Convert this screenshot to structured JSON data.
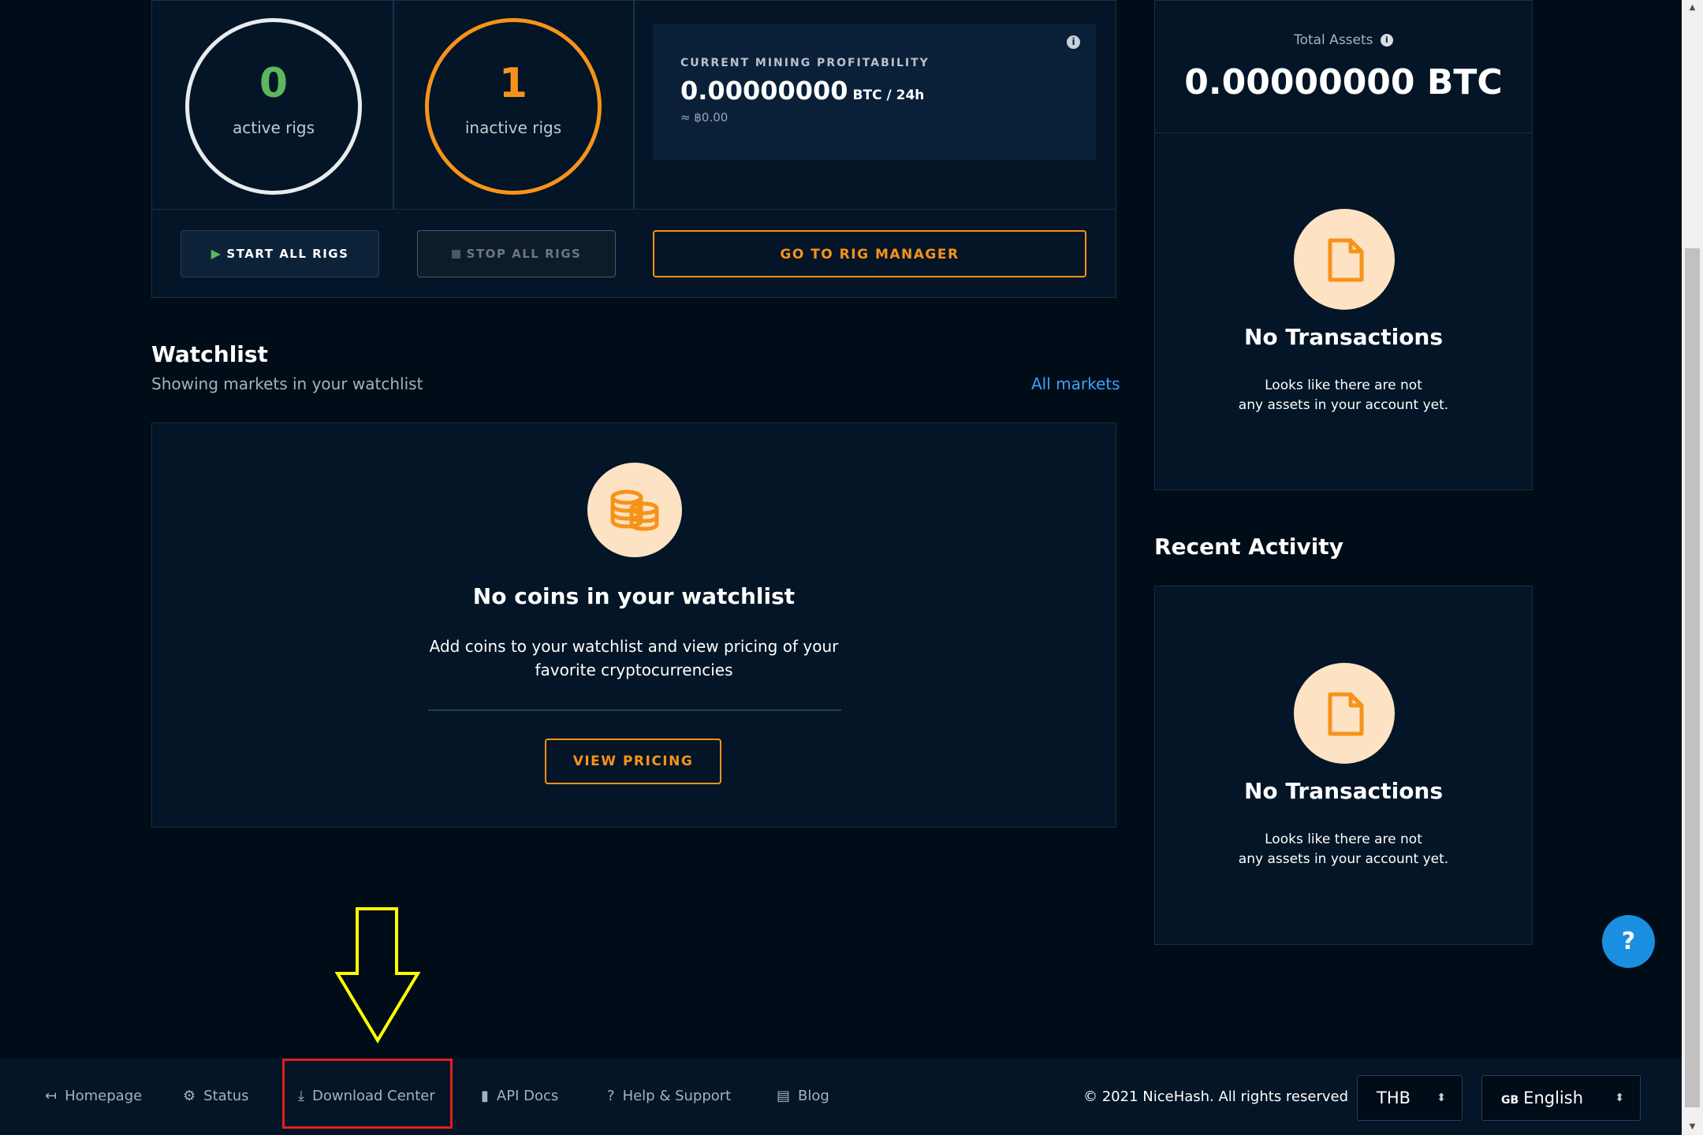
{
  "rigs": {
    "active_count": "0",
    "active_label": "active rigs",
    "inactive_count": "1",
    "inactive_label": "inactive rigs",
    "profitability": {
      "title": "CURRENT MINING PROFITABILITY",
      "value": "0.00000000",
      "unit": "BTC / 24h",
      "fiat": "≈ ฿0.00"
    },
    "start_all": "START ALL RIGS",
    "stop_all": "STOP ALL RIGS",
    "rig_manager": "GO TO RIG MANAGER"
  },
  "watchlist": {
    "title": "Watchlist",
    "subtitle": "Showing markets in your watchlist",
    "all_markets": "All markets",
    "empty_title": "No coins in your watchlist",
    "empty_desc_line1": "Add coins to your watchlist and view pricing of your",
    "empty_desc_line2": "favorite cryptocurrencies",
    "view_pricing": "VIEW PRICING"
  },
  "assets": {
    "label": "Total Assets",
    "value": "0.00000000 BTC",
    "empty_title": "No Transactions",
    "empty_line1": "Looks like there are not",
    "empty_line2": "any assets in your account yet."
  },
  "recent_activity": {
    "title": "Recent Activity",
    "empty_title": "No Transactions",
    "empty_line1": "Looks like there are not",
    "empty_line2": "any assets in your account yet."
  },
  "footer": {
    "links": {
      "homepage": "Homepage",
      "status": "Status",
      "download_center": "Download Center",
      "api_docs": "API Docs",
      "help_support": "Help & Support",
      "blog": "Blog"
    },
    "copyright": "© 2021 NiceHash. All rights reserved",
    "currency": "THB",
    "language_flag": "GB",
    "language": "English"
  },
  "help_button": "?",
  "colors": {
    "background": "#000c17",
    "card": "#031526",
    "accent_orange": "#f7931a",
    "active_green": "#5cb85c",
    "link_blue": "#3ea0ff",
    "annotation_yellow": "#ffff00",
    "annotation_red": "#e02020"
  }
}
